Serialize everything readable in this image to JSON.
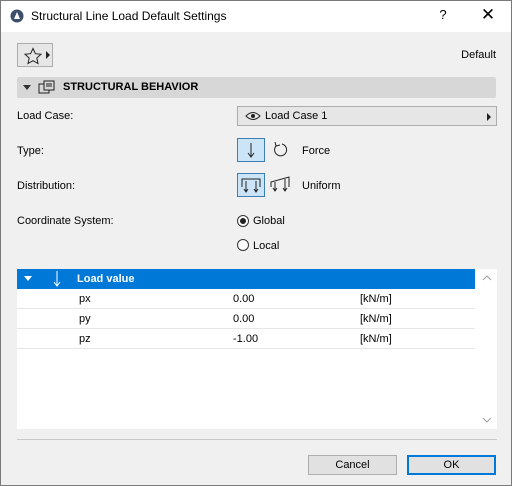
{
  "window": {
    "title": "Structural Line Load Default Settings",
    "help_label": "?",
    "close_label": "✕"
  },
  "favorites": {
    "icon": "star-icon"
  },
  "preset": "Default",
  "section": {
    "title": "STRUCTURAL BEHAVIOR",
    "icon": "structural-settings-icon"
  },
  "fields": {
    "load_case_label": "Load Case:",
    "load_case_value": "Load Case 1",
    "type_label": "Type:",
    "type_value": "Force",
    "distribution_label": "Distribution:",
    "distribution_value": "Uniform",
    "coord_label": "Coordinate System:",
    "coord_options": [
      "Global",
      "Local"
    ],
    "coord_selected": "Global"
  },
  "table": {
    "header": "Load value",
    "rows": [
      {
        "name": "px",
        "value": "0.00",
        "unit": "[kN/m]"
      },
      {
        "name": "py",
        "value": "0.00",
        "unit": "[kN/m]"
      },
      {
        "name": "pz",
        "value": "-1.00",
        "unit": "[kN/m]"
      }
    ]
  },
  "buttons": {
    "cancel": "Cancel",
    "ok": "OK"
  },
  "colors": {
    "accent": "#0078d7",
    "selected_bg": "#cce4f7",
    "section_bg": "#d7d7d7"
  }
}
